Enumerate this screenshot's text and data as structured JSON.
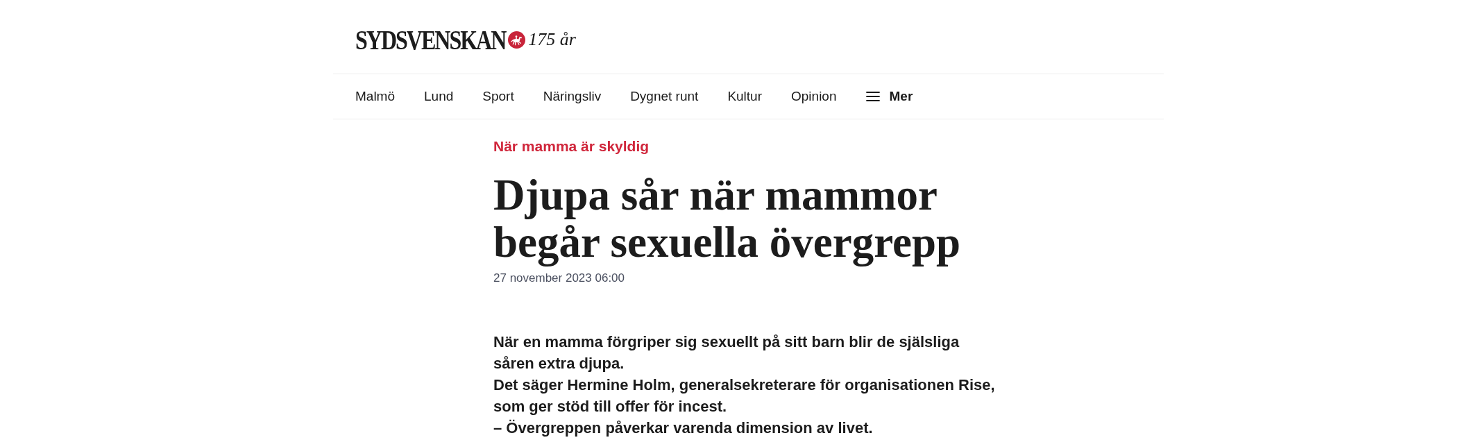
{
  "header": {
    "logo_wordmark": "SYDSVENSKAN",
    "anniversary": "175 år"
  },
  "nav": {
    "items": [
      "Malmö",
      "Lund",
      "Sport",
      "Näringsliv",
      "Dygnet runt",
      "Kultur",
      "Opinion"
    ],
    "more": "Mer"
  },
  "article": {
    "kicker": "När mamma är skyldig",
    "headline": "Djupa sår när mammor begår sexuella övergrepp",
    "date": "27 november 2023 06:00",
    "lead": [
      "När en mamma förgriper sig sexuellt på sitt barn blir de själsliga såren extra djupa.",
      "Det säger Hermine Holm, generalsekreterare för organisationen Rise, som ger stöd till offer för incest.",
      "– Övergreppen påverkar varenda dimension av livet."
    ]
  }
}
